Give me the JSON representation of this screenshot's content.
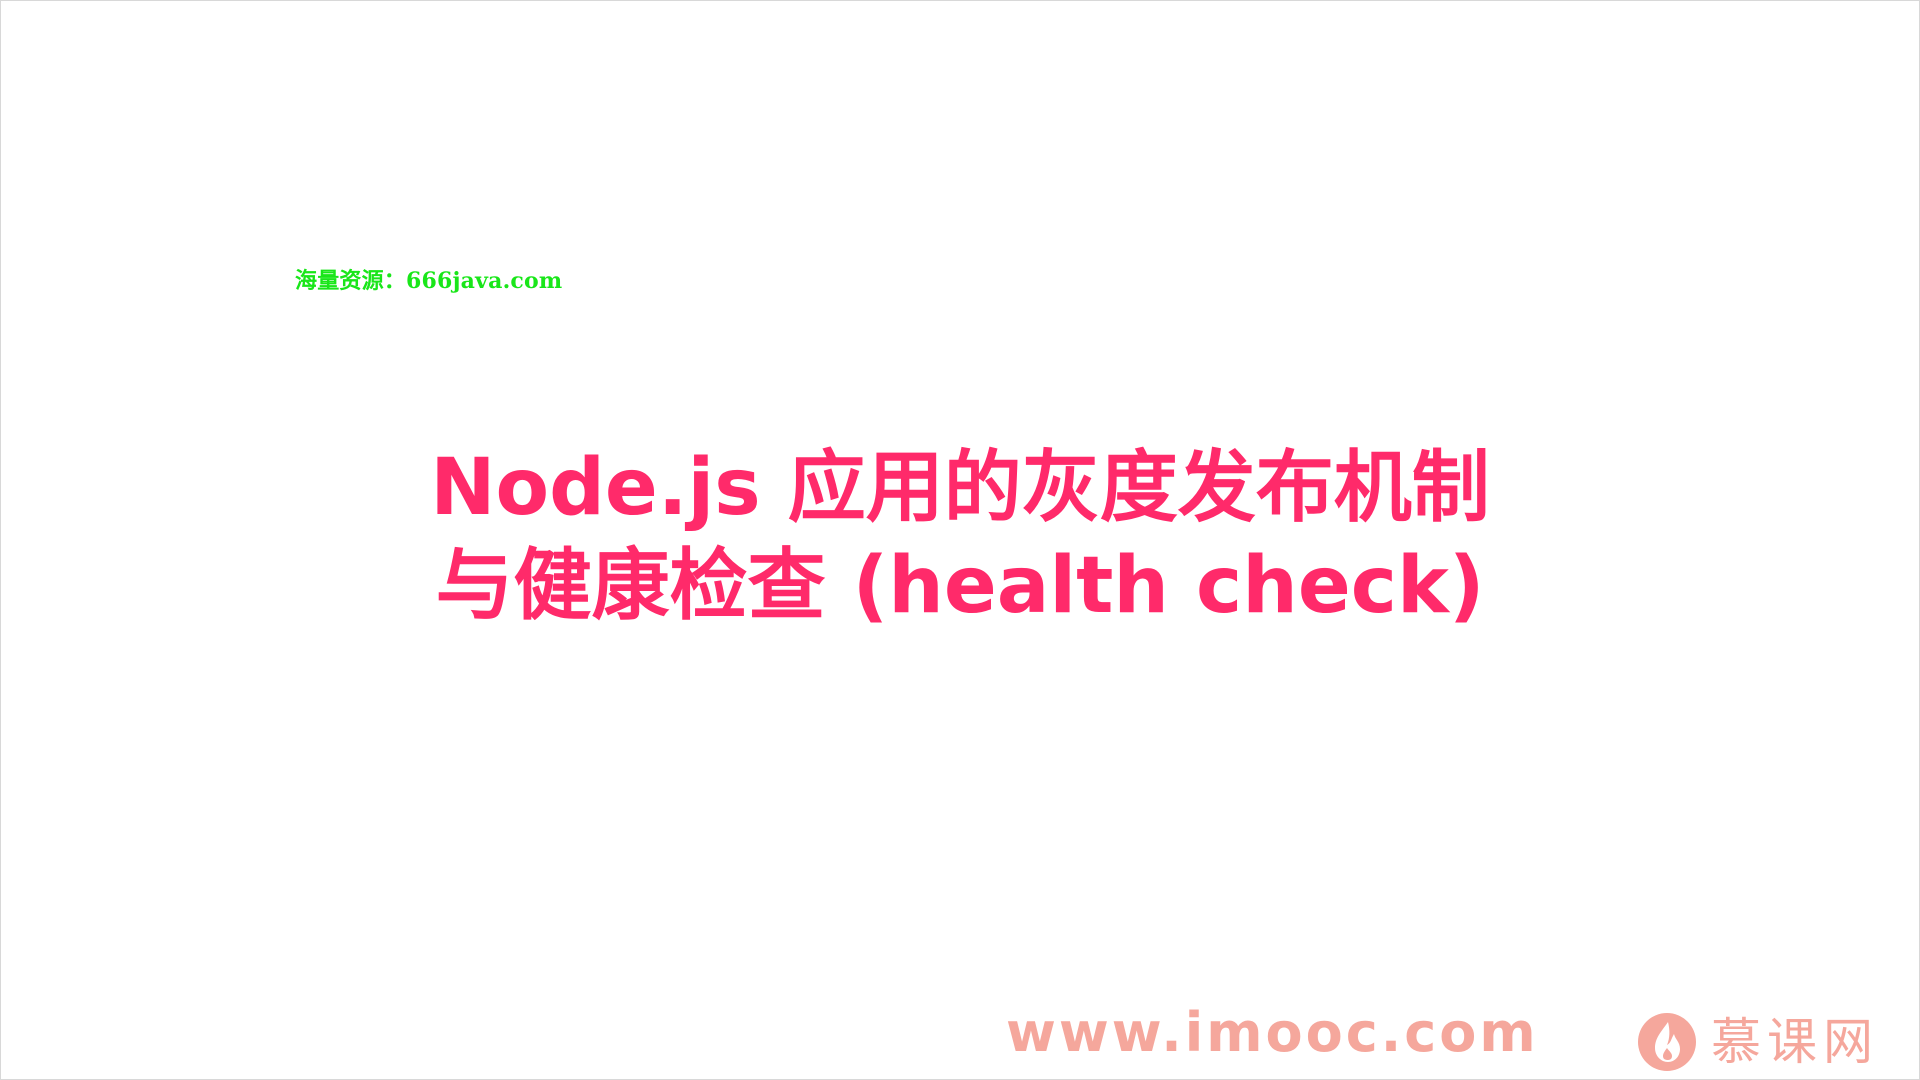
{
  "watermark": {
    "text": "海量资源：666java.com"
  },
  "title": {
    "line1": "Node.js 应用的灰度发布机制",
    "line2": "与健康检查 (health check)"
  },
  "footer": {
    "url": "www.imooc.com",
    "brand_name": "慕课网",
    "brand_icon": "flame-logo-icon"
  },
  "colors": {
    "title": "#ff2a6a",
    "watermark": "#19e619",
    "footer": "#f5a79c"
  }
}
